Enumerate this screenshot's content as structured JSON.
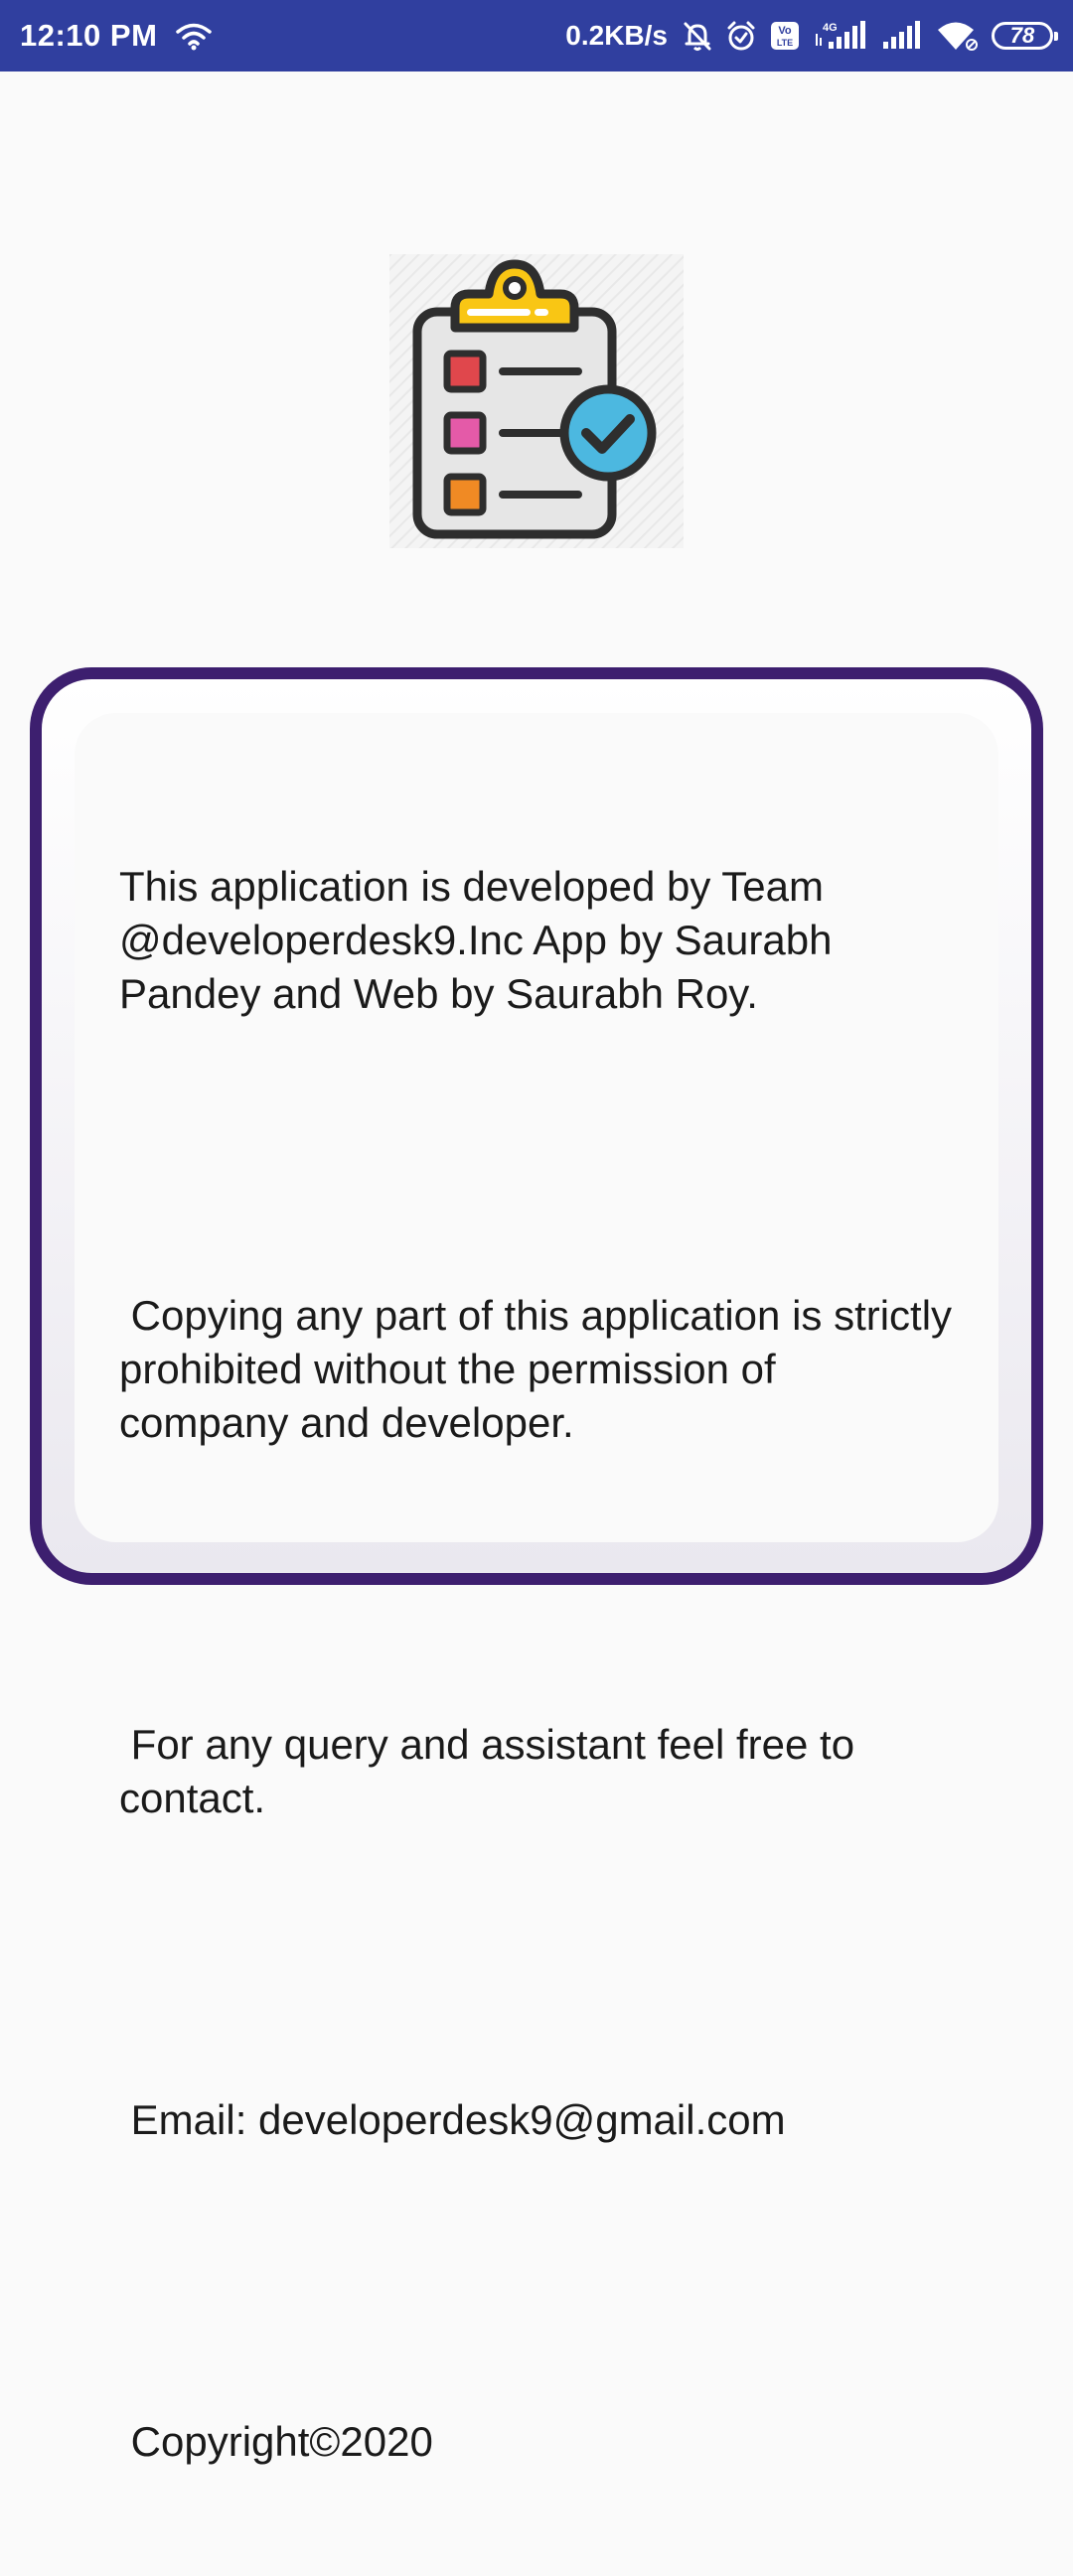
{
  "status_bar": {
    "time": "12:10 PM",
    "net_speed": "0.2KB/s",
    "battery_level": "78",
    "volte_label_top": "Vo",
    "volte_label_bottom": "LTE",
    "network_type": "4G",
    "background_color": "#303f9f"
  },
  "logo": {
    "icon": "checklist-clipboard-icon",
    "colors": {
      "clip": "#f9c614",
      "item1": "#e0474c",
      "item2": "#e45aa8",
      "item3": "#f08a24",
      "check_badge": "#4cb8e0",
      "outline": "#2e2e2e"
    }
  },
  "about": {
    "paragraph_1": "This application is developed by Team @developerdesk9.Inc App by Saurabh Pandey and Web by Saurabh Roy.",
    "paragraph_2": " Copying any part of this application is strictly prohibited without the permission of company and developer.",
    "paragraph_3": " For any query and assistant feel free to contact.",
    "email": " Email: developerdesk9@gmail.com",
    "copyright": " Copyright©2020",
    "border_color": "#3d1f6f"
  }
}
